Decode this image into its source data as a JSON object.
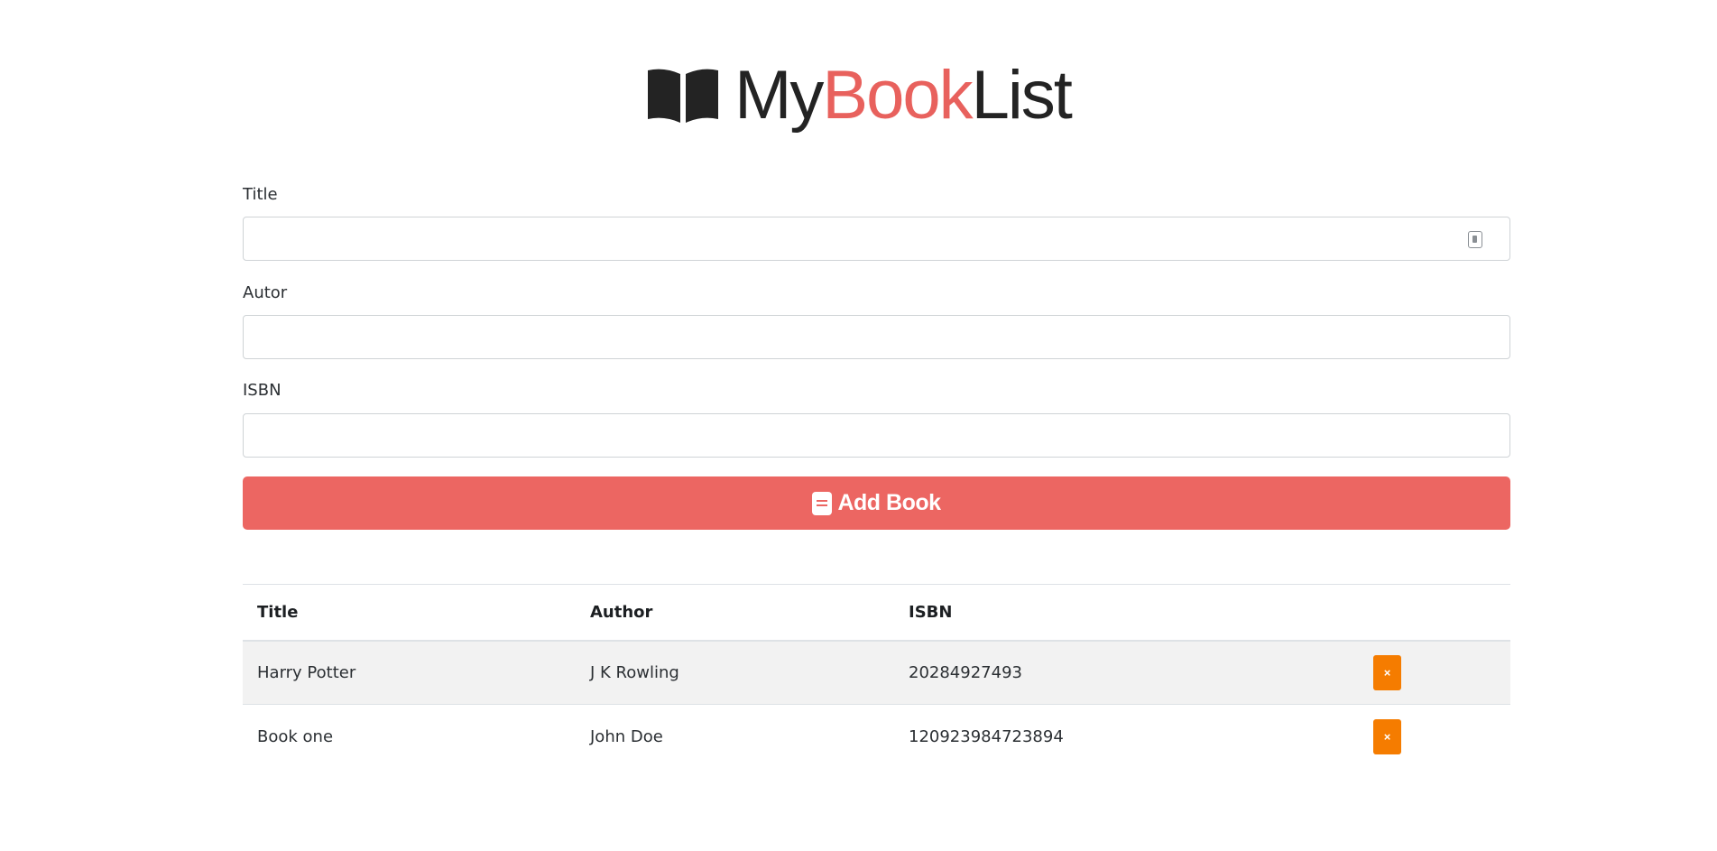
{
  "brand": {
    "part1": "My",
    "part2": "Book",
    "part3": "List",
    "accent": "#e8615d"
  },
  "form": {
    "title_label": "Title",
    "title_value": "",
    "author_label": "Autor",
    "author_value": "",
    "isbn_label": "ISBN",
    "isbn_value": "",
    "submit_label": "Add Book",
    "submit_color": "#ec6662"
  },
  "table": {
    "headers": [
      "Title",
      "Author",
      "ISBN",
      ""
    ],
    "rows": [
      {
        "title": "Harry Potter",
        "author": "J K Rowling",
        "isbn": "20284927493",
        "delete_label": "×"
      },
      {
        "title": "Book one",
        "author": "John Doe",
        "isbn": "120923984723894",
        "delete_label": "×"
      }
    ],
    "delete_color": "#f57c00"
  }
}
